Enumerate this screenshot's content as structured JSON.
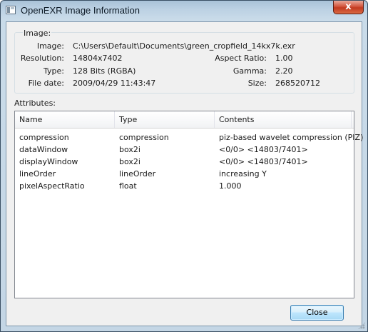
{
  "window": {
    "title": "OpenEXR Image Information",
    "close_glyph": "x",
    "close_button_color": "#c23a20"
  },
  "image_group": {
    "label": "Image:",
    "fields": {
      "image_label": "Image:",
      "image_value": "C:\\Users\\Default\\Documents\\green_cropfield_14kx7k.exr",
      "resolution_label": "Resolution:",
      "resolution_value": "14804x7402",
      "aspect_label": "Aspect Ratio:",
      "aspect_value": "1.00",
      "type_label": "Type:",
      "type_value": "128 Bits (RGBA)",
      "gamma_label": "Gamma:",
      "gamma_value": "2.20",
      "date_label": "File date:",
      "date_value": "2009/04/29 11:43:47",
      "size_label": "Size:",
      "size_value": "268520712"
    }
  },
  "attributes": {
    "label": "Attributes:",
    "columns": [
      "Name",
      "Type",
      "Contents"
    ],
    "rows": [
      [
        "compression",
        "compression",
        "piz-based wavelet compression (PIZ)"
      ],
      [
        "dataWindow",
        "box2i",
        "<0/0> <14803/7401>"
      ],
      [
        "displayWindow",
        "box2i",
        "<0/0> <14803/7401>"
      ],
      [
        "lineOrder",
        "lineOrder",
        "increasing Y"
      ],
      [
        "pixelAspectRatio",
        "float",
        "1.000"
      ]
    ]
  },
  "footer": {
    "close_label": "Close"
  },
  "icons": {
    "app": "openexr-window-icon",
    "grip": "resize-grip-icon"
  }
}
